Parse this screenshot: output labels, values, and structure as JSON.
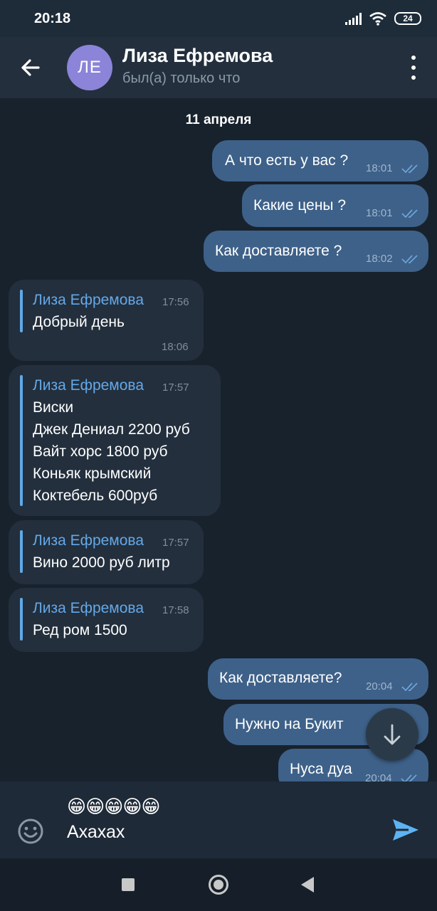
{
  "status_bar": {
    "time": "20:18",
    "battery": "24"
  },
  "header": {
    "avatar_initials": "ЛЕ",
    "contact_name": "Лиза Ефремова",
    "contact_status": "был(а) только что"
  },
  "chat": {
    "date_label": "11 апреля",
    "outgoing_top": [
      {
        "text": "А что есть у вас ?",
        "time": "18:01"
      },
      {
        "text": "Какие цены ?",
        "time": "18:01"
      },
      {
        "text": "Как доставляете ?",
        "time": "18:02"
      }
    ],
    "incoming": [
      {
        "sender": "Лиза Ефремова",
        "sender_time": "17:56",
        "lines": [
          "Добрый день"
        ],
        "time": "18:06"
      },
      {
        "sender": "Лиза Ефремова",
        "sender_time": "17:57",
        "lines": [
          "Виски",
          "Джек Дениал 2200 руб",
          "Вайт хорс 1800 руб",
          "Коньяк крымский",
          "Коктебель 600руб"
        ],
        "time": ""
      },
      {
        "sender": "Лиза Ефремова",
        "sender_time": "17:57",
        "lines": [
          "Вино 2000 руб литр"
        ],
        "time": ""
      },
      {
        "sender": "Лиза Ефремова",
        "sender_time": "17:58",
        "lines": [
          "Ред ром 1500"
        ],
        "time": ""
      }
    ],
    "outgoing_bottom": [
      {
        "text": "Как доставляете?",
        "time": "20:04"
      },
      {
        "text": "Нужно на Букит",
        "time": ""
      },
      {
        "text": "Нуса дуа",
        "time": "20:04"
      }
    ]
  },
  "input": {
    "emoji_line": "😁😁😁😁😁",
    "text": "Ахахах"
  },
  "colors": {
    "outgoing_bubble": "#3e6189",
    "incoming_bubble": "#232f3d",
    "sender_name": "#64a8e8",
    "send_icon": "#5db3f2"
  },
  "icons": {
    "back": "arrow-left-icon",
    "menu": "more-vertical-icon",
    "emoji": "smiley-icon",
    "send": "paper-plane-icon",
    "scroll": "arrow-down-icon"
  }
}
